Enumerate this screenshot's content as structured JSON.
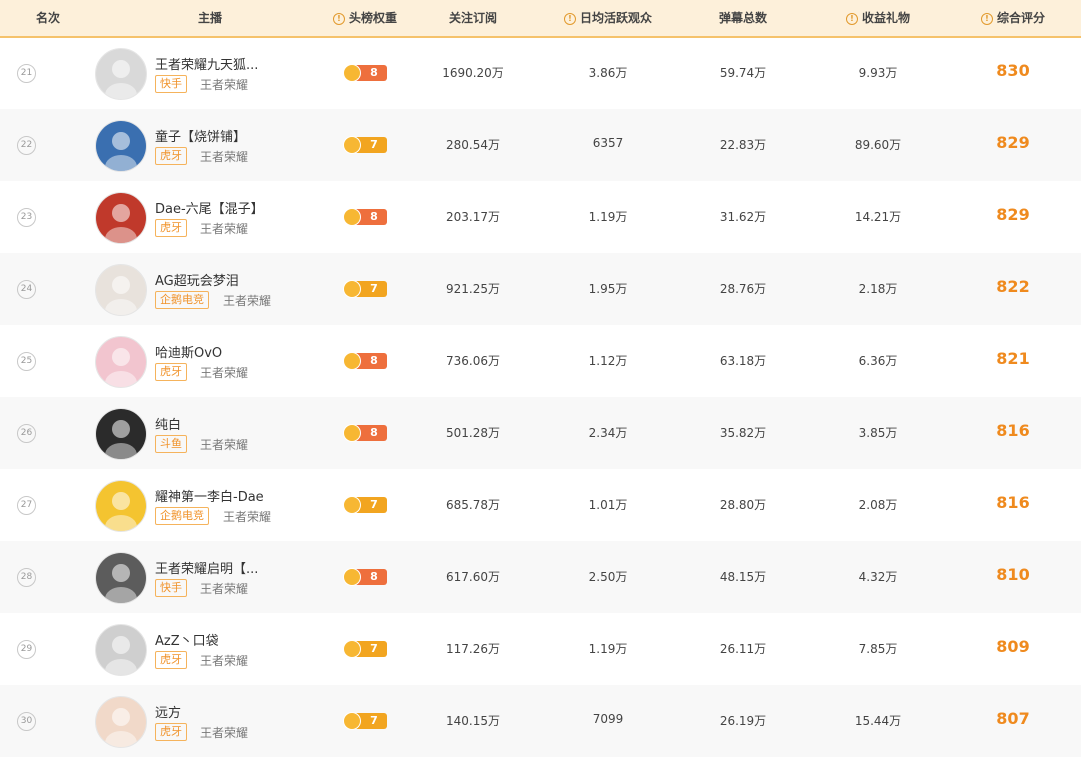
{
  "header": {
    "rank": "名次",
    "streamer": "主播",
    "weight": "头榜权重",
    "subs": "关注订阅",
    "daily": "日均活跃观众",
    "danmaku": "弹幕总数",
    "gifts": "收益礼物",
    "score": "综合评分",
    "info_glyph": "!"
  },
  "colors": {
    "accent": "#ef8a1e",
    "header_bg": "#fdf0da",
    "badge_8": "#ee6f3d",
    "badge_7": "#f2a520"
  },
  "rows": [
    {
      "rank": "21",
      "name": "王者荣耀九天狐...",
      "platform": "快手",
      "game": "王者荣耀",
      "weight": "8",
      "subs": "1690.20万",
      "daily": "3.86万",
      "danmaku": "59.74万",
      "gifts": "9.93万",
      "score": "830"
    },
    {
      "rank": "22",
      "name": "童子【烧饼铺】",
      "platform": "虎牙",
      "game": "王者荣耀",
      "weight": "7",
      "subs": "280.54万",
      "daily": "6357",
      "danmaku": "22.83万",
      "gifts": "89.60万",
      "score": "829"
    },
    {
      "rank": "23",
      "name": "Dae-六尾【混子】",
      "platform": "虎牙",
      "game": "王者荣耀",
      "weight": "8",
      "subs": "203.17万",
      "daily": "1.19万",
      "danmaku": "31.62万",
      "gifts": "14.21万",
      "score": "829"
    },
    {
      "rank": "24",
      "name": "AG超玩会梦泪",
      "platform": "企鹅电竞",
      "game": "王者荣耀",
      "weight": "7",
      "subs": "921.25万",
      "daily": "1.95万",
      "danmaku": "28.76万",
      "gifts": "2.18万",
      "score": "822"
    },
    {
      "rank": "25",
      "name": "哈迪斯OvO",
      "platform": "虎牙",
      "game": "王者荣耀",
      "weight": "8",
      "subs": "736.06万",
      "daily": "1.12万",
      "danmaku": "63.18万",
      "gifts": "6.36万",
      "score": "821"
    },
    {
      "rank": "26",
      "name": "纯白",
      "platform": "斗鱼",
      "game": "王者荣耀",
      "weight": "8",
      "subs": "501.28万",
      "daily": "2.34万",
      "danmaku": "35.82万",
      "gifts": "3.85万",
      "score": "816"
    },
    {
      "rank": "27",
      "name": "耀神第一李白-Dae",
      "platform": "企鹅电竞",
      "game": "王者荣耀",
      "weight": "7",
      "subs": "685.78万",
      "daily": "1.01万",
      "danmaku": "28.80万",
      "gifts": "2.08万",
      "score": "816"
    },
    {
      "rank": "28",
      "name": "王者荣耀启明【...",
      "platform": "快手",
      "game": "王者荣耀",
      "weight": "8",
      "subs": "617.60万",
      "daily": "2.50万",
      "danmaku": "48.15万",
      "gifts": "4.32万",
      "score": "810"
    },
    {
      "rank": "29",
      "name": "AzZ丶口袋",
      "platform": "虎牙",
      "game": "王者荣耀",
      "weight": "7",
      "subs": "117.26万",
      "daily": "1.19万",
      "danmaku": "26.11万",
      "gifts": "7.85万",
      "score": "809"
    },
    {
      "rank": "30",
      "name": "远方",
      "platform": "虎牙",
      "game": "王者荣耀",
      "weight": "7",
      "subs": "140.15万",
      "daily": "7099",
      "danmaku": "26.19万",
      "gifts": "15.44万",
      "score": "807"
    }
  ]
}
